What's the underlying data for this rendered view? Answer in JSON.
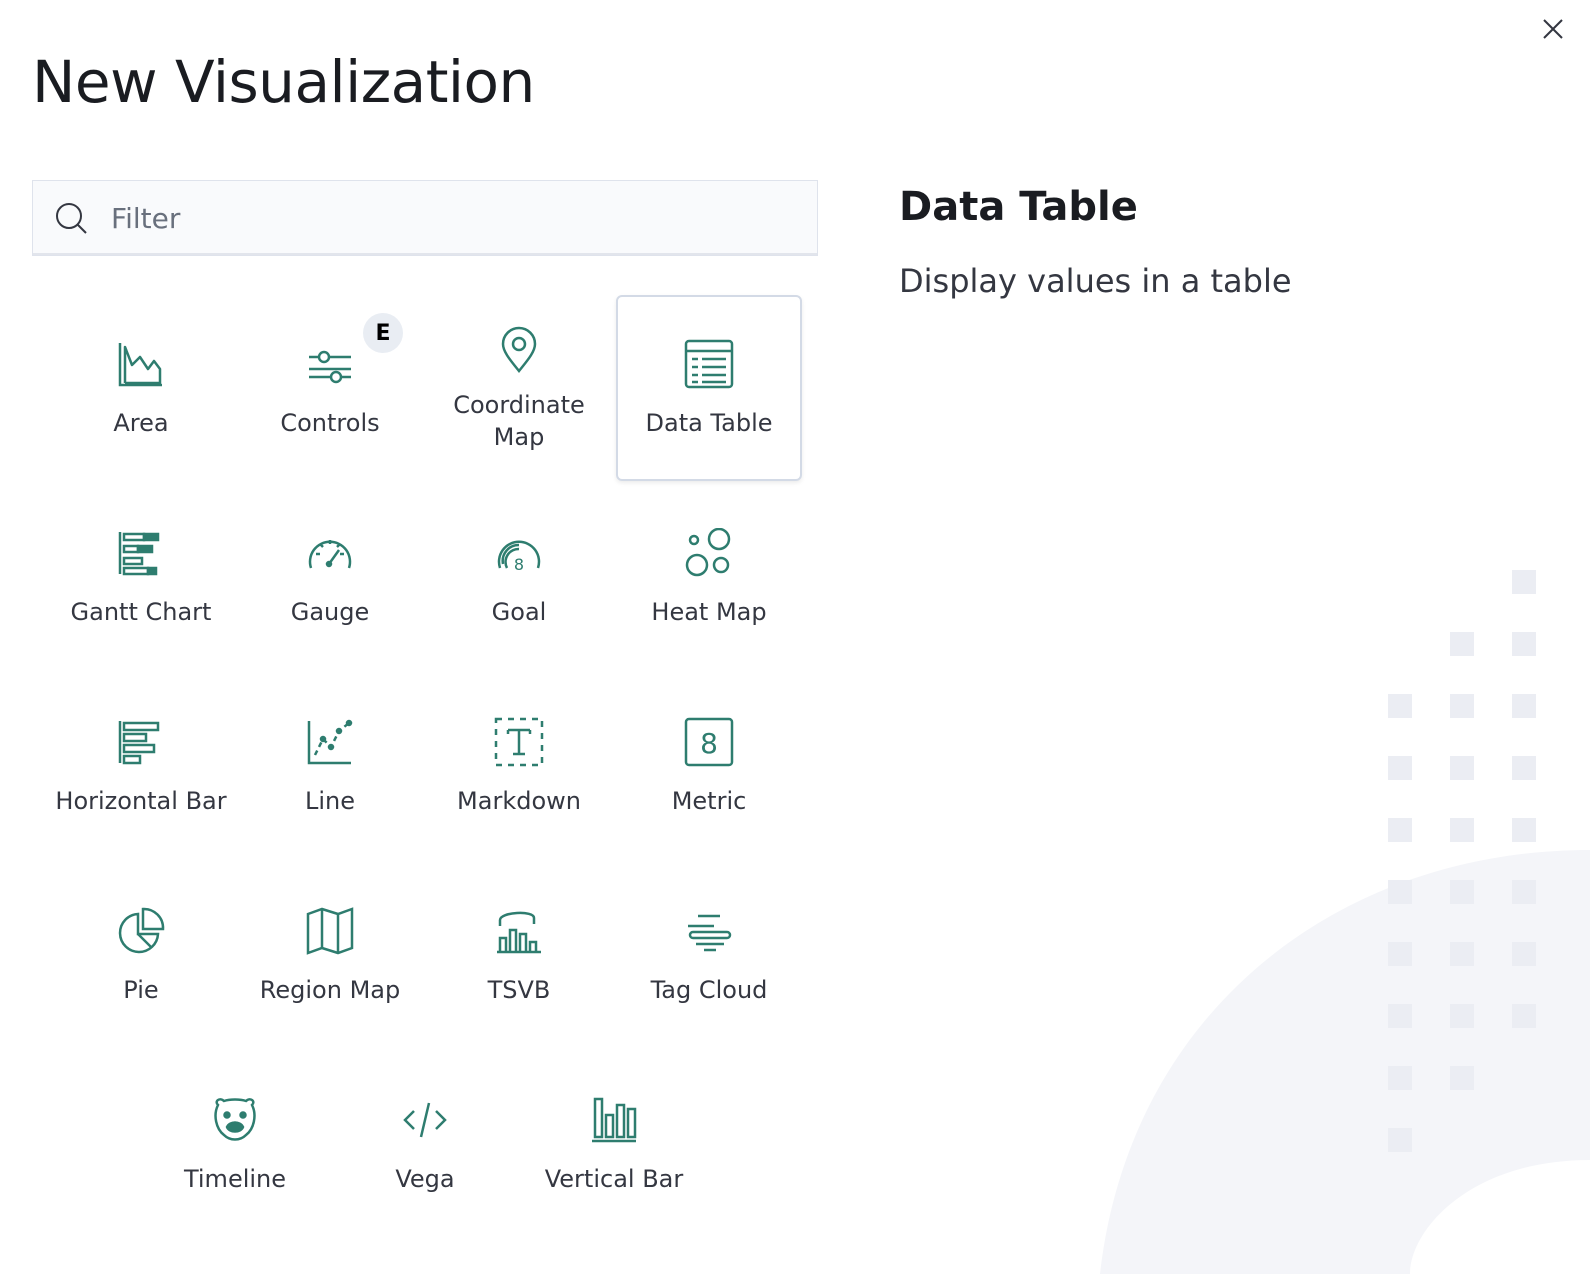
{
  "modal": {
    "title": "New Visualization"
  },
  "filter": {
    "placeholder": "Filter",
    "value": ""
  },
  "visualizations": [
    {
      "label": "Area",
      "icon": "area-chart-icon"
    },
    {
      "label": "Controls",
      "icon": "controls-icon",
      "badge": "E"
    },
    {
      "label": "Coordinate\nMap",
      "icon": "map-marker-icon"
    },
    {
      "label": "Data Table",
      "icon": "table-icon",
      "selected": true
    },
    {
      "label": "Gantt Chart",
      "icon": "gantt-chart-icon"
    },
    {
      "label": "Gauge",
      "icon": "gauge-icon"
    },
    {
      "label": "Goal",
      "icon": "goal-icon"
    },
    {
      "label": "Heat Map",
      "icon": "heatmap-icon"
    },
    {
      "label": "Horizontal Bar",
      "icon": "horizontal-bar-icon"
    },
    {
      "label": "Line",
      "icon": "line-chart-icon"
    },
    {
      "label": "Markdown",
      "icon": "markdown-icon"
    },
    {
      "label": "Metric",
      "icon": "metric-icon"
    },
    {
      "label": "Pie",
      "icon": "pie-chart-icon"
    },
    {
      "label": "Region Map",
      "icon": "region-map-icon"
    },
    {
      "label": "TSVB",
      "icon": "tsvb-icon"
    },
    {
      "label": "Tag Cloud",
      "icon": "tag-cloud-icon"
    },
    {
      "label": "Timeline",
      "icon": "timeline-icon"
    },
    {
      "label": "Vega",
      "icon": "code-icon"
    },
    {
      "label": "Vertical Bar",
      "icon": "vertical-bar-icon"
    }
  ],
  "description": {
    "title": "Data Table",
    "text": "Display values in a table"
  },
  "colors": {
    "icon": "#2e7d6f",
    "label": "#343741",
    "selected_border": "#d3dae6",
    "decor": "#f0f2f7"
  }
}
